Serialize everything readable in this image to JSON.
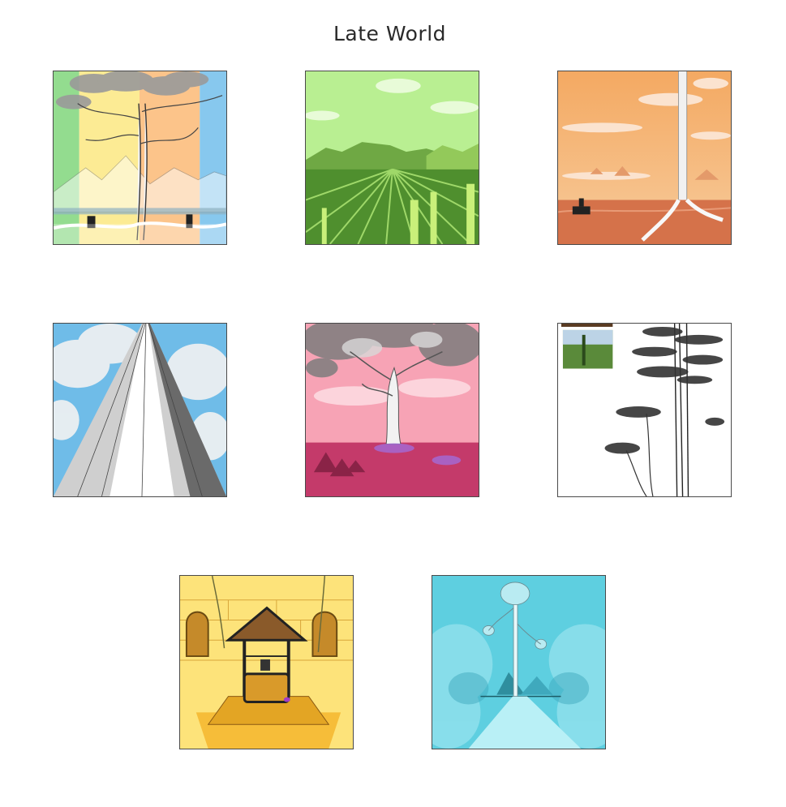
{
  "page": {
    "title": "Late World"
  },
  "gallery": {
    "items": [
      {
        "art": "rainbow-sketch-tree"
      },
      {
        "art": "green-field-perspective"
      },
      {
        "art": "orange-desert-tree"
      },
      {
        "art": "grey-tower-sky"
      },
      {
        "art": "pink-blossom-tree"
      },
      {
        "art": "ink-pine-trees"
      },
      {
        "art": "golden-wishing-well"
      },
      {
        "art": "cyan-cloud-tree"
      }
    ]
  }
}
